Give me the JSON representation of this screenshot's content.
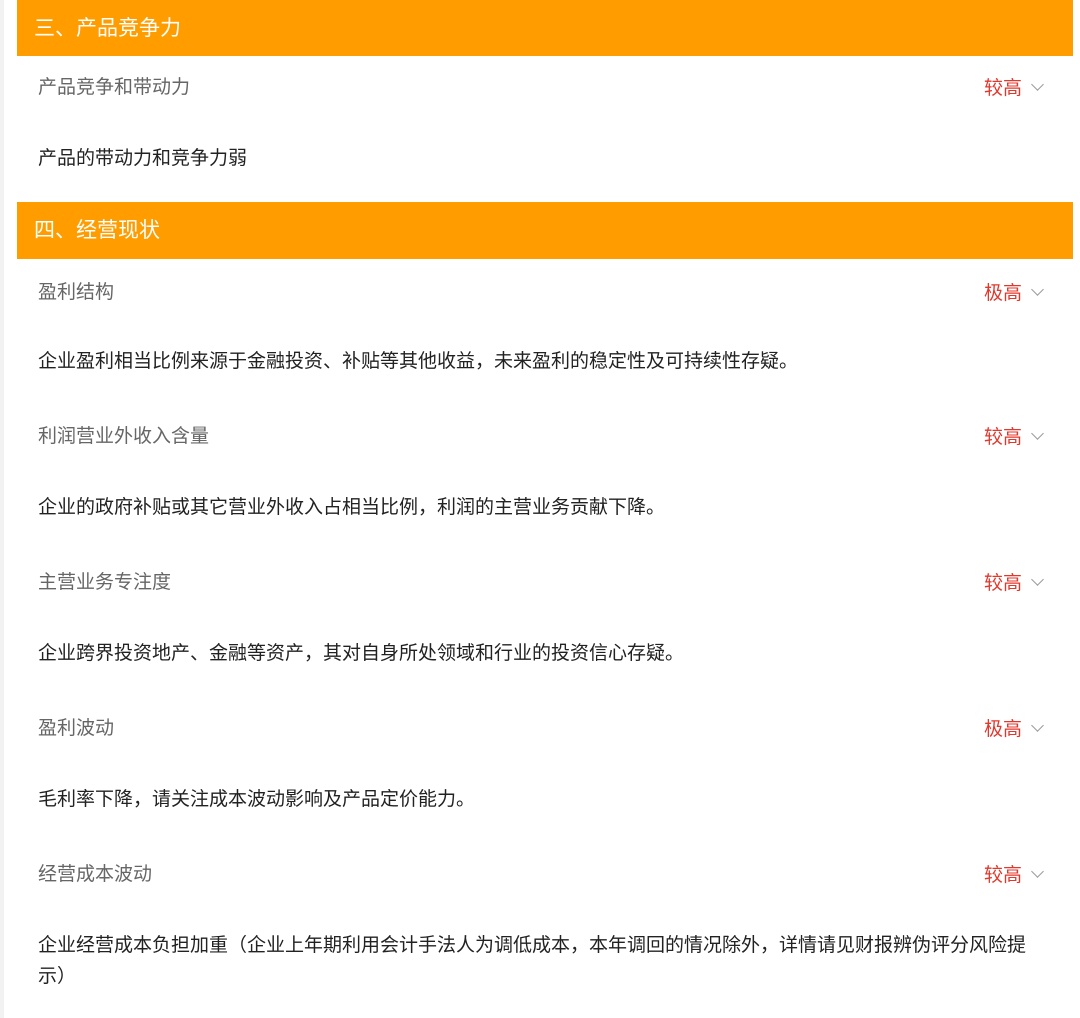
{
  "sections": [
    {
      "title": "三、产品竞争力",
      "items": [
        {
          "title": "产品竞争和带动力",
          "level": "较高",
          "desc": "产品的带动力和竞争力弱"
        }
      ]
    },
    {
      "title": "四、经营现状",
      "items": [
        {
          "title": "盈利结构",
          "level": "极高",
          "desc": "企业盈利相当比例来源于金融投资、补贴等其他收益，未来盈利的稳定性及可持续性存疑。"
        },
        {
          "title": "利润营业外收入含量",
          "level": "较高",
          "desc": "企业的政府补贴或其它营业外收入占相当比例，利润的主营业务贡献下降。"
        },
        {
          "title": "主营业务专注度",
          "level": "较高",
          "desc": "企业跨界投资地产、金融等资产，其对自身所处领域和行业的投资信心存疑。"
        },
        {
          "title": "盈利波动",
          "level": "极高",
          "desc": "毛利率下降，请关注成本波动影响及产品定价能力。"
        },
        {
          "title": "经营成本波动",
          "level": "较高",
          "desc": "企业经营成本负担加重（企业上年期利用会计手法人为调低成本，本年调回的情况除外，详情请见财报辨伪评分风险提示）"
        }
      ]
    }
  ],
  "icons": {
    "expand": "chevron-down-icon"
  },
  "colors": {
    "header_bg": "#ff9d00",
    "level_text": "#e2372b"
  }
}
